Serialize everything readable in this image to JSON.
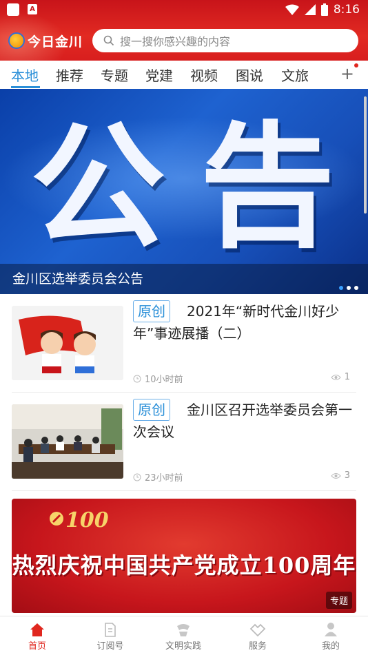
{
  "status_bar": {
    "time": "8:16",
    "notification_letter": "A"
  },
  "header": {
    "app_name": "今日金川",
    "search_placeholder": "搜一搜你感兴趣的内容"
  },
  "tabs": [
    {
      "label": "本地",
      "active": true
    },
    {
      "label": "推荐"
    },
    {
      "label": "专题"
    },
    {
      "label": "党建"
    },
    {
      "label": "视频"
    },
    {
      "label": "图说"
    },
    {
      "label": "文旅"
    }
  ],
  "banner": {
    "big_text_1": "公",
    "big_text_2": "告",
    "caption": "金川区选举委员会公告",
    "slide_index": 1,
    "slide_count": 3
  },
  "news": [
    {
      "tag": "原创",
      "title": "2021年“新时代金川好少年”事迹展播（二）",
      "time": "10小时前",
      "views": "1"
    },
    {
      "tag": "原创",
      "title": "金川区召开选举委员会第一次会议",
      "time": "23小时前",
      "views": "3"
    }
  ],
  "promo": {
    "logo_text": "100",
    "headline": "热烈庆祝中国共产党成立100周年",
    "label": "专题"
  },
  "bottom_nav": [
    {
      "label": "首页",
      "active": true
    },
    {
      "label": "订阅号"
    },
    {
      "label": "文明实践"
    },
    {
      "label": "服务"
    },
    {
      "label": "我的"
    }
  ],
  "colors": {
    "brand_red": "#e0271f",
    "tab_active": "#2a8fd8"
  }
}
